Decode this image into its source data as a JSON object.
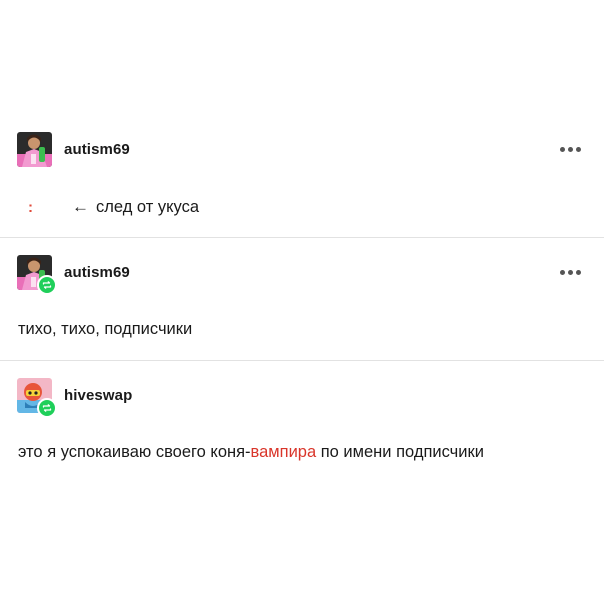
{
  "posts": [
    {
      "username": "autism69",
      "colon_mark": ":",
      "link_arrow": "←",
      "link_text": "след от укуса"
    },
    {
      "username": "autism69",
      "text": "тихо, тихо, подписчики"
    },
    {
      "username": "hiveswap",
      "text_before": "это я успокаиваю своего коня-",
      "text_highlight": "вампира",
      "text_after": " по имени подписчики"
    }
  ],
  "colors": {
    "highlight": "#d9352a",
    "reblog_badge": "#1fcf5a",
    "divider": "#e2e2e2"
  },
  "icons": {
    "more": "three-dots-horizontal",
    "reblog": "reblog-arrows",
    "back": "arrow-left"
  }
}
